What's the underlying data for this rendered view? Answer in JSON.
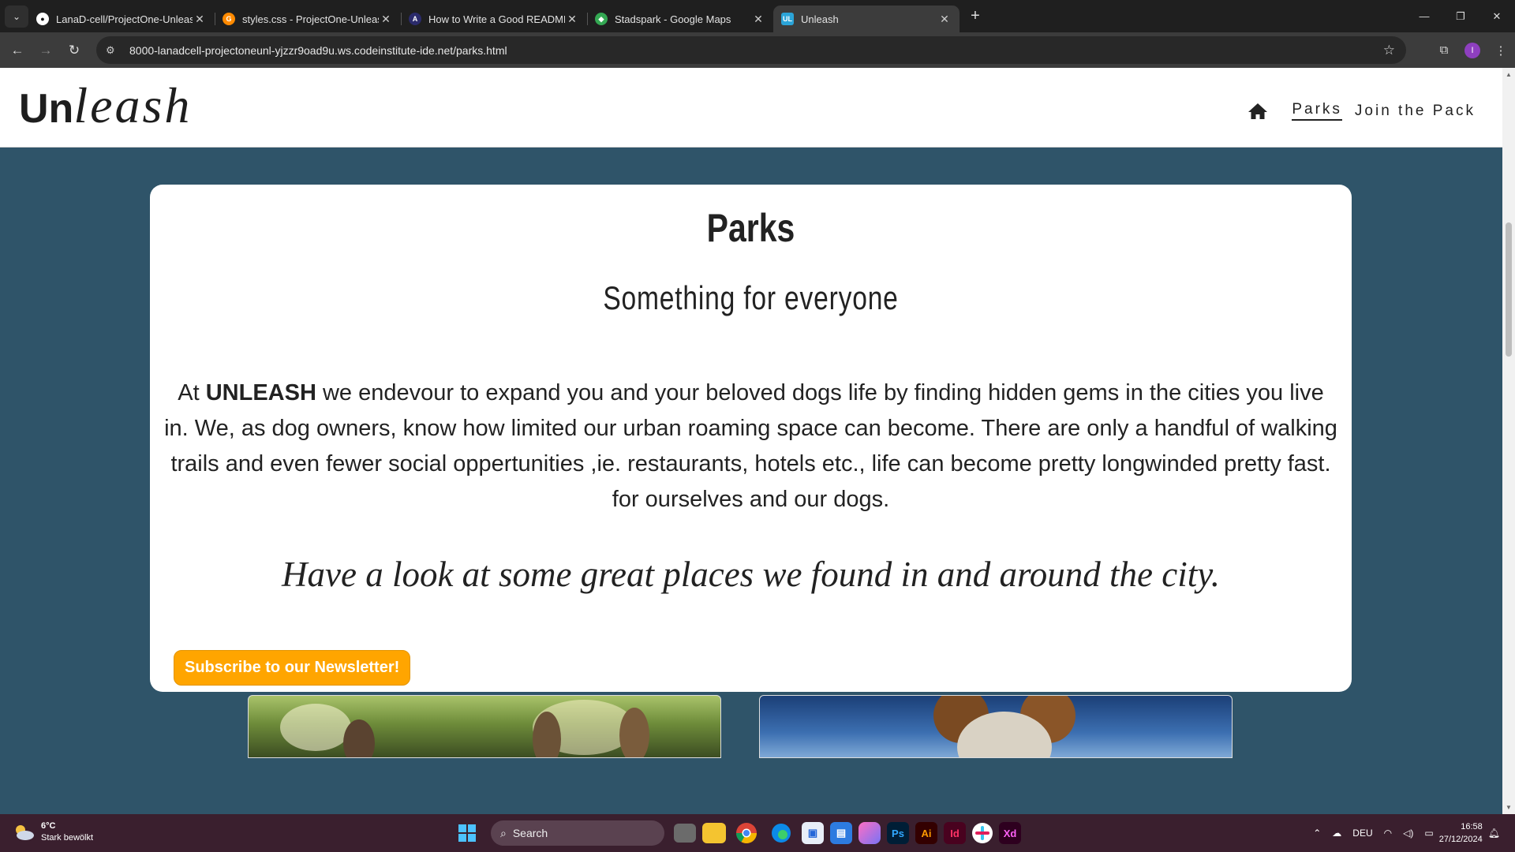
{
  "browser": {
    "tabs": [
      {
        "title": "LanaD-cell/ProjectOne-Unleash",
        "favicon": "github-icon",
        "color": "#ffffff",
        "active": false
      },
      {
        "title": "styles.css - ProjectOne-Unleash",
        "favicon": "gitpod-icon",
        "color": "#ff8a00",
        "active": false
      },
      {
        "title": "How to Write a Good README",
        "favicon": "readme-icon",
        "color": "#2b2b6b",
        "active": false
      },
      {
        "title": "Stadspark - Google Maps",
        "favicon": "maps-pin-icon",
        "color": "#34a853",
        "active": false
      },
      {
        "title": "Unleash",
        "favicon": "unleash-ul-icon",
        "color": "#2ba4d8",
        "active": true
      }
    ],
    "url": "8000-lanadcell-projectoneunl-yjzzr9oad9u.ws.codeinstitute-ide.net/parks.html",
    "profile_initial": "I"
  },
  "site": {
    "logo_bold": "Un",
    "logo_italic": "leash",
    "nav": {
      "parks": "Parks",
      "join": "Join the Pack"
    }
  },
  "card": {
    "heading": "Parks",
    "subheading": "Something for everyone",
    "intro_prefix": "At ",
    "intro_brand": "UNLEASH",
    "intro_rest": " we endevour to expand you and your beloved dogs life by finding hidden gems in the cities you live in. We, as dog owners, know how limited our urban roaming space can become. There are only a handful of walking trails and even fewer social oppertunities ,ie. restaurants, hotels etc., life can become pretty longwinded pretty fast. for ourselves and our dogs.",
    "tagline": "Have a look at some great places we found in and around the city.",
    "newsletter_button": "Subscribe to our Newsletter!"
  },
  "taskbar": {
    "temperature": "6°C",
    "weather_desc": "Stark bewölkt",
    "search_placeholder": "Search",
    "language": "DEU",
    "time": "16:58",
    "date": "27/12/2024"
  },
  "colors": {
    "page_bg": "#2f5469",
    "button_bg": "#ffa500",
    "taskbar_bg": "#3a1f2e"
  }
}
